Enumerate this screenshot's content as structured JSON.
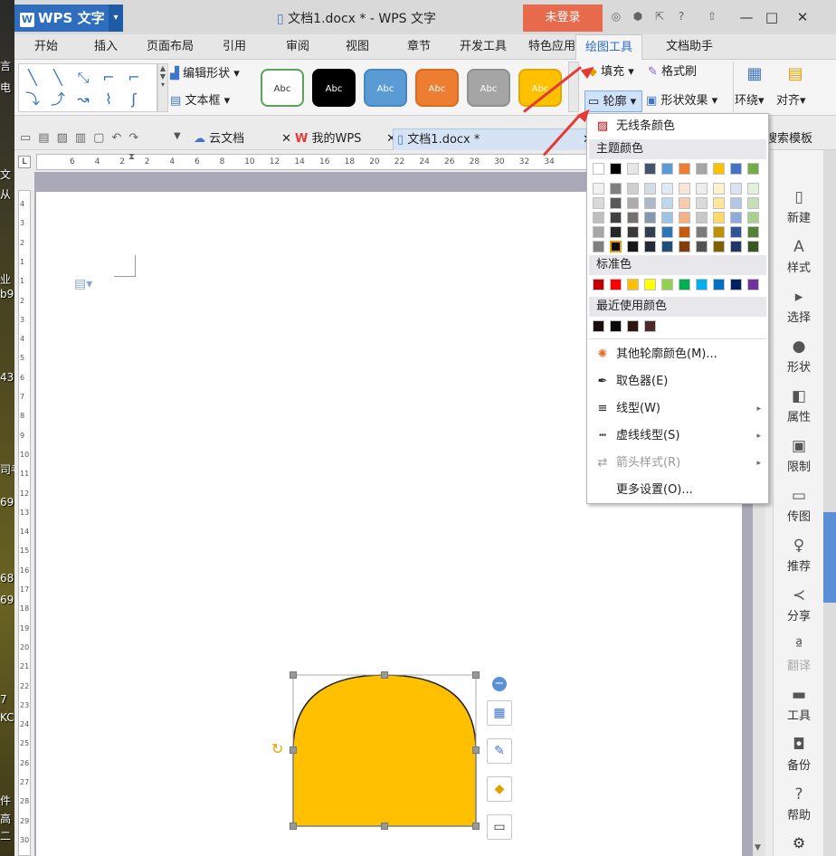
{
  "desktop": {
    "fragments": [
      "言",
      "电",
      "文",
      "从",
      "业",
      "b9",
      "43",
      "司考",
      "69",
      "68",
      "69",
      "7",
      "KC",
      "件",
      "高",
      "二"
    ]
  },
  "titlebar": {
    "app_name": "WPS 文字",
    "logo": "W",
    "window_title": "文档1.docx * - WPS 文字",
    "login": "未登录"
  },
  "tabs": [
    "开始",
    "插入",
    "页面布局",
    "引用",
    "审阅",
    "视图",
    "章节",
    "开发工具",
    "特色应用",
    "绘图工具",
    "文档助手"
  ],
  "active_tab": "绘图工具",
  "ribbon": {
    "edit_shape": "编辑形状",
    "textbox": "文本框",
    "style_label": "Abc",
    "styles": [
      {
        "bg": "#ffffff",
        "fg": "#333333",
        "border": "#5aa35a"
      },
      {
        "bg": "#000000",
        "fg": "#ffffff",
        "border": "#000000"
      },
      {
        "bg": "#5b9bd5",
        "fg": "#ffffff",
        "border": "#4a86c0"
      },
      {
        "bg": "#ed7d31",
        "fg": "#ffffff",
        "border": "#d96c20"
      },
      {
        "bg": "#a5a5a5",
        "fg": "#ffffff",
        "border": "#909090"
      },
      {
        "bg": "#ffc000",
        "fg": "#ffffff",
        "border": "#e0aa00"
      }
    ],
    "fill": "填充",
    "format_painter": "格式刷",
    "outline": "轮廓",
    "shape_effect": "形状效果",
    "wrap": "环绕",
    "align": "对齐",
    "template_search": "搜索模板"
  },
  "doc_tabs": [
    {
      "label": "云文档",
      "icon": "cloud-icon"
    },
    {
      "label": "我的WPS",
      "icon": "wps-icon"
    },
    {
      "label": "文档1.docx *",
      "icon": "doc-icon"
    }
  ],
  "ruler": {
    "h_ticks": [
      "6",
      "4",
      "2",
      "2",
      "4",
      "6",
      "8",
      "10",
      "12",
      "14",
      "16",
      "18",
      "20",
      "22",
      "24",
      "26",
      "28",
      "30",
      "32",
      "34"
    ],
    "v_ticks": [
      "4",
      "3",
      "2",
      "1",
      "1",
      "2",
      "3",
      "4",
      "5",
      "6",
      "7",
      "8",
      "9",
      "10",
      "11",
      "12",
      "13",
      "14",
      "15",
      "16",
      "17",
      "18",
      "19",
      "20",
      "21",
      "22",
      "23",
      "24",
      "25",
      "26",
      "27",
      "28",
      "29",
      "30"
    ]
  },
  "outline_menu": {
    "no_line": "无线条颜色",
    "theme_colors_title": "主题颜色",
    "theme_row": [
      "#ffffff",
      "#000000",
      "#e7e6e6",
      "#44546a",
      "#5b9bd5",
      "#ed7d31",
      "#a5a5a5",
      "#ffc000",
      "#4472c4",
      "#70ad47"
    ],
    "theme_grid": [
      [
        "#f2f2f2",
        "#7f7f7f",
        "#d0cece",
        "#d6dce5",
        "#deebf7",
        "#fbe5d6",
        "#ededed",
        "#fff2cc",
        "#dae3f3",
        "#e2f0d9"
      ],
      [
        "#d9d9d9",
        "#595959",
        "#aeabab",
        "#adb9ca",
        "#bdd7ee",
        "#f8cbad",
        "#dbdbdb",
        "#ffe699",
        "#b4c7e7",
        "#c5e0b4"
      ],
      [
        "#bfbfbf",
        "#404040",
        "#767171",
        "#8497b0",
        "#9dc3e6",
        "#f4b183",
        "#c9c9c9",
        "#ffd966",
        "#8faadc",
        "#a9d18e"
      ],
      [
        "#a6a6a6",
        "#262626",
        "#3b3838",
        "#333f50",
        "#2e75b6",
        "#c55a11",
        "#7b7b7b",
        "#bf9000",
        "#2f5597",
        "#548235"
      ],
      [
        "#808080",
        "#0d0d0d",
        "#171616",
        "#222a35",
        "#1f4e79",
        "#843c0c",
        "#525252",
        "#7f6000",
        "#203864",
        "#385723"
      ]
    ],
    "standard_title": "标准色",
    "standard_colors": [
      "#c00000",
      "#ff0000",
      "#ffc000",
      "#ffff00",
      "#92d050",
      "#00b050",
      "#00b0f0",
      "#0070c0",
      "#002060",
      "#7030a0"
    ],
    "recent_title": "最近使用颜色",
    "recent_colors": [
      "#1a0d0d",
      "#0a0a0a",
      "#2d1510",
      "#4a2a2a"
    ],
    "items": [
      {
        "label": "其他轮廓颜色(M)...",
        "icon": "color-wheel-icon",
        "disabled": false,
        "submenu": false
      },
      {
        "label": "取色器(E)",
        "icon": "eyedropper-icon",
        "disabled": false,
        "submenu": false
      },
      {
        "label": "线型(W)",
        "icon": "line-style-icon",
        "disabled": false,
        "submenu": true
      },
      {
        "label": "虚线线型(S)",
        "icon": "dash-style-icon",
        "disabled": false,
        "submenu": true
      },
      {
        "label": "箭头样式(R)",
        "icon": "arrow-style-icon",
        "disabled": true,
        "submenu": true
      },
      {
        "label": "更多设置(O)...",
        "icon": "",
        "disabled": false,
        "submenu": false
      }
    ]
  },
  "right_panel": [
    "新建",
    "样式",
    "选择",
    "形状",
    "属性",
    "限制",
    "传图",
    "推荐",
    "分享",
    "翻译",
    "工具",
    "备份",
    "帮助"
  ],
  "shape": {
    "fill": "#ffc000",
    "stroke": "#222222"
  }
}
